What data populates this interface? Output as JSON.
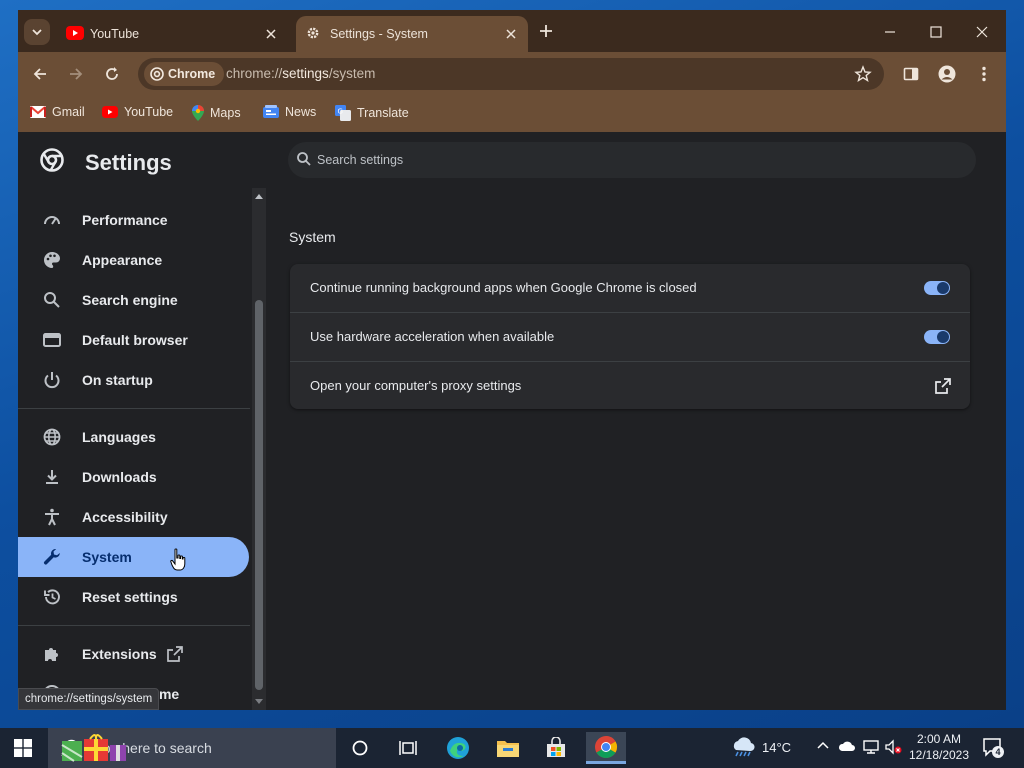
{
  "browser": {
    "tabs": [
      {
        "title": "YouTube",
        "favicon": "youtube-icon",
        "active": false
      },
      {
        "title": "Settings - System",
        "favicon": "gear-icon",
        "active": true
      }
    ],
    "omnibox": {
      "chip_label": "Chrome",
      "url_scheme": "chrome://",
      "url_host": "settings",
      "url_path": "/system"
    },
    "bookmarks": [
      {
        "label": "Gmail",
        "icon": "gmail-icon"
      },
      {
        "label": "YouTube",
        "icon": "youtube-icon"
      },
      {
        "label": "Maps",
        "icon": "maps-icon"
      },
      {
        "label": "News",
        "icon": "news-icon"
      },
      {
        "label": "Translate",
        "icon": "translate-icon"
      }
    ],
    "theme_colors": {
      "frame": "#3b2a1e",
      "toolbar": "#6b4e36",
      "omnibox": "#4c3727"
    }
  },
  "settings": {
    "title": "Settings",
    "search_placeholder": "Search settings",
    "nav": [
      {
        "label": "Performance",
        "icon": "performance-gauge-icon"
      },
      {
        "label": "Appearance",
        "icon": "palette-icon"
      },
      {
        "label": "Search engine",
        "icon": "search-icon"
      },
      {
        "label": "Default browser",
        "icon": "browser-window-icon"
      },
      {
        "label": "On startup",
        "icon": "power-icon"
      },
      {
        "label": "Languages",
        "icon": "globe-icon"
      },
      {
        "label": "Downloads",
        "icon": "download-icon"
      },
      {
        "label": "Accessibility",
        "icon": "accessibility-icon"
      },
      {
        "label": "System",
        "icon": "wrench-icon",
        "active": true
      },
      {
        "label": "Reset settings",
        "icon": "history-icon"
      },
      {
        "label": "Extensions",
        "icon": "puzzle-icon"
      },
      {
        "label": "About Chrome",
        "icon": "chrome-icon"
      }
    ],
    "section_title": "System",
    "rows": [
      {
        "label": "Continue running background apps when Google Chrome is closed",
        "control": "toggle",
        "on": true
      },
      {
        "label": "Use hardware acceleration when available",
        "control": "toggle",
        "on": true
      },
      {
        "label": "Open your computer's proxy settings",
        "control": "external-link-icon"
      }
    ],
    "accent": "#8ab4f8"
  },
  "status_tooltip": "chrome://settings/system",
  "taskbar": {
    "search_placeholder": "Type here to search",
    "apps": [
      "cortana-icon",
      "task-view-icon",
      "edge-icon",
      "file-explorer-icon",
      "store-icon",
      "chrome-icon"
    ],
    "weather": {
      "temp": "14°C",
      "icon": "rain-cloud-icon"
    },
    "time": "2:00 AM",
    "date": "12/18/2023",
    "notification_count": "4"
  }
}
